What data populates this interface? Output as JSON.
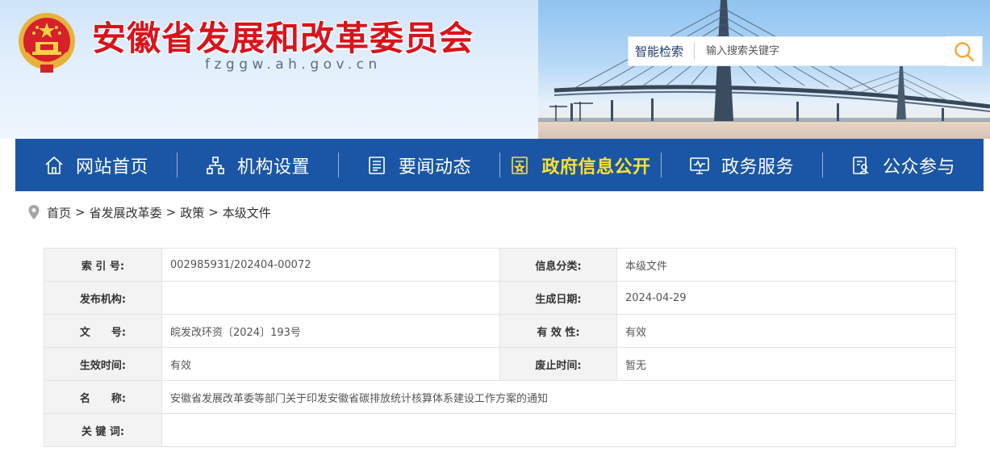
{
  "header": {
    "site_title": "安徽省发展和改革委员会",
    "site_domain": "fzggw.ah.gov.cn",
    "emblem_icon": "national-emblem-icon",
    "banner_image": "bridge-skyline-banner",
    "search": {
      "label": "智能检索",
      "placeholder": "输入搜索关键字",
      "button_icon": "search-icon"
    }
  },
  "nav": {
    "items": [
      {
        "label": "网站首页",
        "icon": "home-icon",
        "active": false
      },
      {
        "label": "机构设置",
        "icon": "org-chart-icon",
        "active": false
      },
      {
        "label": "要闻动态",
        "icon": "news-icon",
        "active": false
      },
      {
        "label": "政府信息公开",
        "icon": "gov-info-icon",
        "active": true
      },
      {
        "label": "政务服务",
        "icon": "service-monitor-icon",
        "active": false
      },
      {
        "label": "公众参与",
        "icon": "public-participation-icon",
        "active": false
      }
    ]
  },
  "breadcrumb": {
    "icon": "location-pin-icon",
    "items": [
      "首页",
      "省发展改革委",
      "政策",
      "本级文件"
    ],
    "separator": ">"
  },
  "info": {
    "index_label": "索 引 号:",
    "index_value": "002985931/202404-00072",
    "category_label": "信息分类:",
    "category_value": "本级文件",
    "publisher_label": "发布机构:",
    "publisher_value": "",
    "date_label": "生成日期:",
    "date_value": "2024-04-29",
    "docno_label": "文　　号:",
    "docno_value": "皖发改环资〔2024〕193号",
    "validity_label": "有 效 性:",
    "validity_value": "有效",
    "effective_label": "生效时间:",
    "effective_value": "有效",
    "expiry_label": "废止时间:",
    "expiry_value": "暂无",
    "name_label": "名　　称:",
    "name_value": "安徽省发展改革委等部门关于印发安徽省碳排放统计核算体系建设工作方案的通知",
    "keywords_label": "关 键 词:",
    "keywords_value": ""
  },
  "colors": {
    "nav_bg": "#1a56a5",
    "title_red": "#d8141c",
    "active_nav": "#ffe22a",
    "search_accent": "#f2a93b"
  }
}
